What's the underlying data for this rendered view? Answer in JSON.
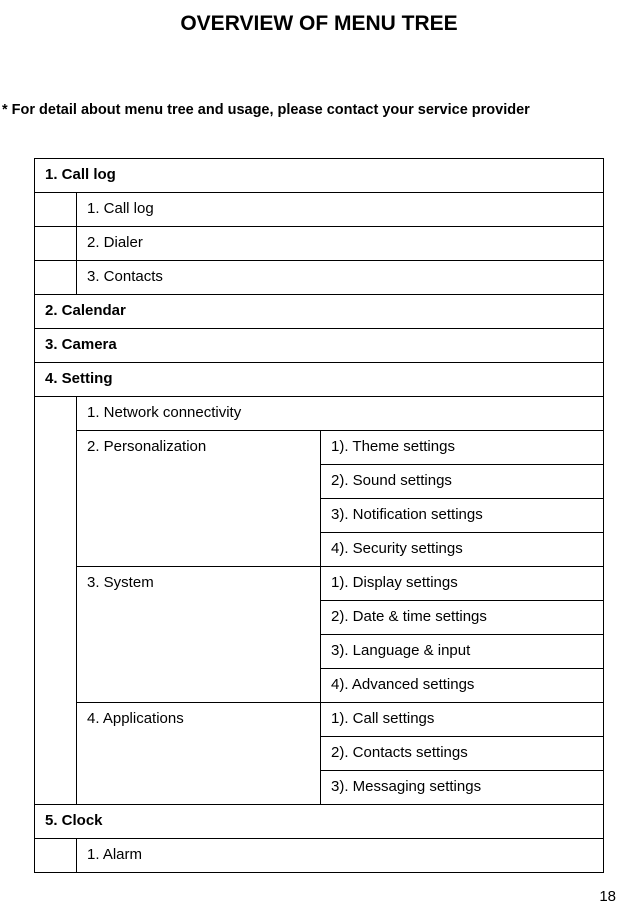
{
  "title": "OVERVIEW OF MENU TREE",
  "note": "* For detail about menu tree and usage, please contact your service provider",
  "pageNumber": "18",
  "menu": {
    "section1": {
      "header": "1. Call  log",
      "items": [
        "1.  Call  log",
        "2.  Dialer",
        "3.  Contacts"
      ]
    },
    "section2": {
      "header": "2. Calendar"
    },
    "section3": {
      "header": "3. Camera"
    },
    "section4": {
      "header": "4. Setting",
      "sub1": "1.  Network  connectivity",
      "sub2": {
        "label": "2.  Personalization",
        "items": [
          "1).  Theme  settings",
          "2).  Sound  settings",
          "3).  Notification  settings",
          "4).  Security  settings"
        ]
      },
      "sub3": {
        "label": "3.  System",
        "items": [
          "1).  Display  settings",
          "2).  Date  &  time  settings",
          "3).  Language  &  input",
          "4).  Advanced  settings"
        ]
      },
      "sub4": {
        "label": "4.  Applications",
        "items": [
          "1).  Call  settings",
          "2).  Contacts  settings",
          "3).  Messaging  settings"
        ]
      }
    },
    "section5": {
      "header": "5.  Clock",
      "items": [
        "1. Alarm"
      ]
    }
  }
}
